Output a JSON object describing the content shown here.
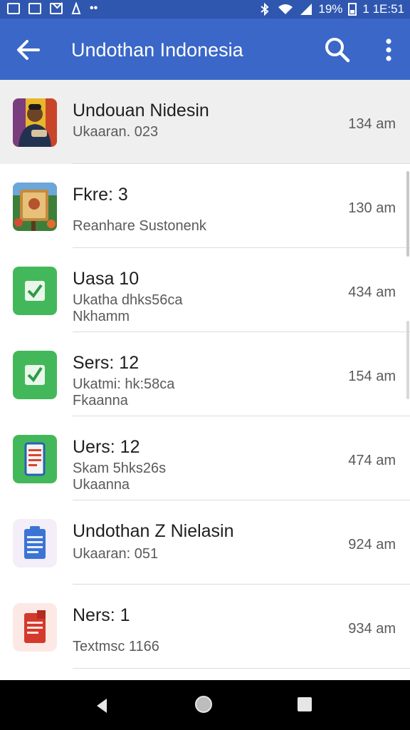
{
  "status_bar": {
    "battery_text": "19%",
    "time": "1 1E:51"
  },
  "app_bar": {
    "title": "Undothan Indonesia",
    "icons": [
      "back-arrow-icon",
      "search-icon",
      "more-vert-icon"
    ]
  },
  "list": {
    "items": [
      {
        "title": "Undouan Nidesin",
        "subtitle": "Ukaaran. 023",
        "time": "134 am",
        "icon": "person-photo-thumbnail",
        "selected": true
      },
      {
        "title": "Fkre: 3",
        "subtitle": "Reanhare Sustonenk",
        "time": "130 am",
        "icon": "sign-photo-thumbnail"
      },
      {
        "title": "Uasa 10",
        "subtitle": "Ukatha dhks56ca\nNkhamm",
        "time": "434 am",
        "icon": "green-check-icon"
      },
      {
        "title": "Sers: 12",
        "subtitle": "Ukatmi: hk:58ca\nFkaanna",
        "time": "154 am",
        "icon": "green-checkbox-icon"
      },
      {
        "title": "Uers: 12",
        "subtitle": "Skam 5hks26s\nUkaanna",
        "time": "474 am",
        "icon": "green-phone-icon"
      },
      {
        "title": "Undothan Z Nielasin",
        "subtitle": "Ukaaran: 051",
        "time": "924 am",
        "icon": "blue-clipboard-icon"
      },
      {
        "title": "Ners: 1",
        "subtitle": "Textmsc 1166",
        "time": "934 am",
        "icon": "red-document-icon"
      }
    ]
  },
  "colors": {
    "status_bar": "#2f57b0",
    "app_bar": "#3a67c8",
    "green_app": "#43b85a",
    "selected_row": "#efefef"
  }
}
